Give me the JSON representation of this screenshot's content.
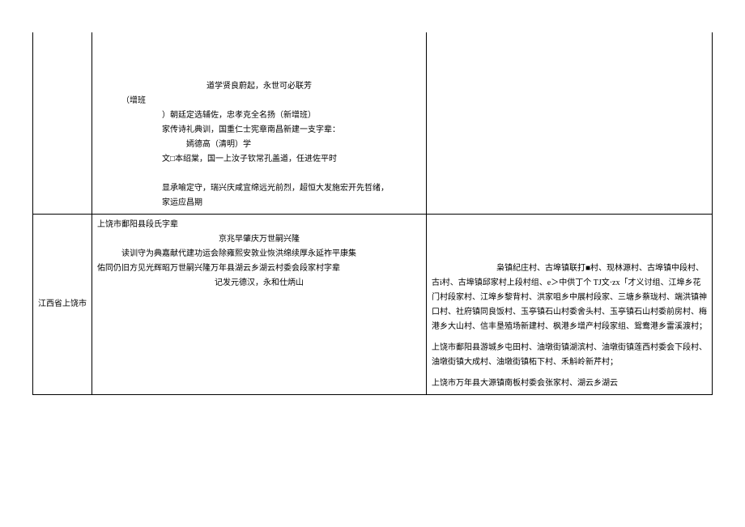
{
  "row1": {
    "middle": {
      "line1": "道学贤良蔚起，永世可必联芳",
      "line2a": "（增班",
      "line2b": "）朝廷定选辅佐，忠孝克全名扬（新增班）",
      "line3": "家传诗礼典训，国重仁士宪章南昌新建一支字辈：",
      "line4": "嫣德高（清明）学",
      "line5": "文□本绍棠，国一上汝子钦常孔盖道，任进佐平时",
      "line6": "显承喻定守，瑞兴庆咸宜绵远光前烈，超恒大发施宏开先哲绪，",
      "line7": "家运应昌期"
    },
    "right": ""
  },
  "row2": {
    "region": "江西省上饶市",
    "middle": {
      "line1": "上饶市鄱阳县段氏字辈",
      "line2": "京兆早肇庆万世嗣兴隆",
      "line3": "读训守为典嘉献代建功运会除雍熙安敦业恢洪绵续厚永延祚平康集",
      "line4": "佑同仍旧方见光辉昭万世嗣兴隆万年县湖云乡湖云村委会段家村字辈",
      "line5": "记发元德汉，永和仕炳山"
    },
    "right": {
      "p1": "枭镇纪庄村、古埠镇联打■村、现林源村、古埠镇中段村、古i村、古埠镇邱家村上段村组、e＞中供丁个 TJ文·zx「才义讨组、江埠乡花门村段家村、江埠乡黎背村、洪家咀乡中展村段家、三塘乡蔡珑村、端洪镇神口村、社府镇同良饭村、玉亭镇石山村委舍头村、玉亭镇石山村委前房村、梅港乡大山村、信丰垦殖场新建村、枫港乡增产村段家组、鸳鸯港乡雷溪渡村；",
      "p2": "上饶市鄱阳县游城乡屯田村、油墩街镇湖滨村、油墩街镇莲西村委会下段村、油墩街镇大成村、油墩街镇柘下村、禾斛岭新芹村；",
      "p3": "上饶市万年县大源镇南板村委会张家村、湖云乡湖云"
    }
  }
}
